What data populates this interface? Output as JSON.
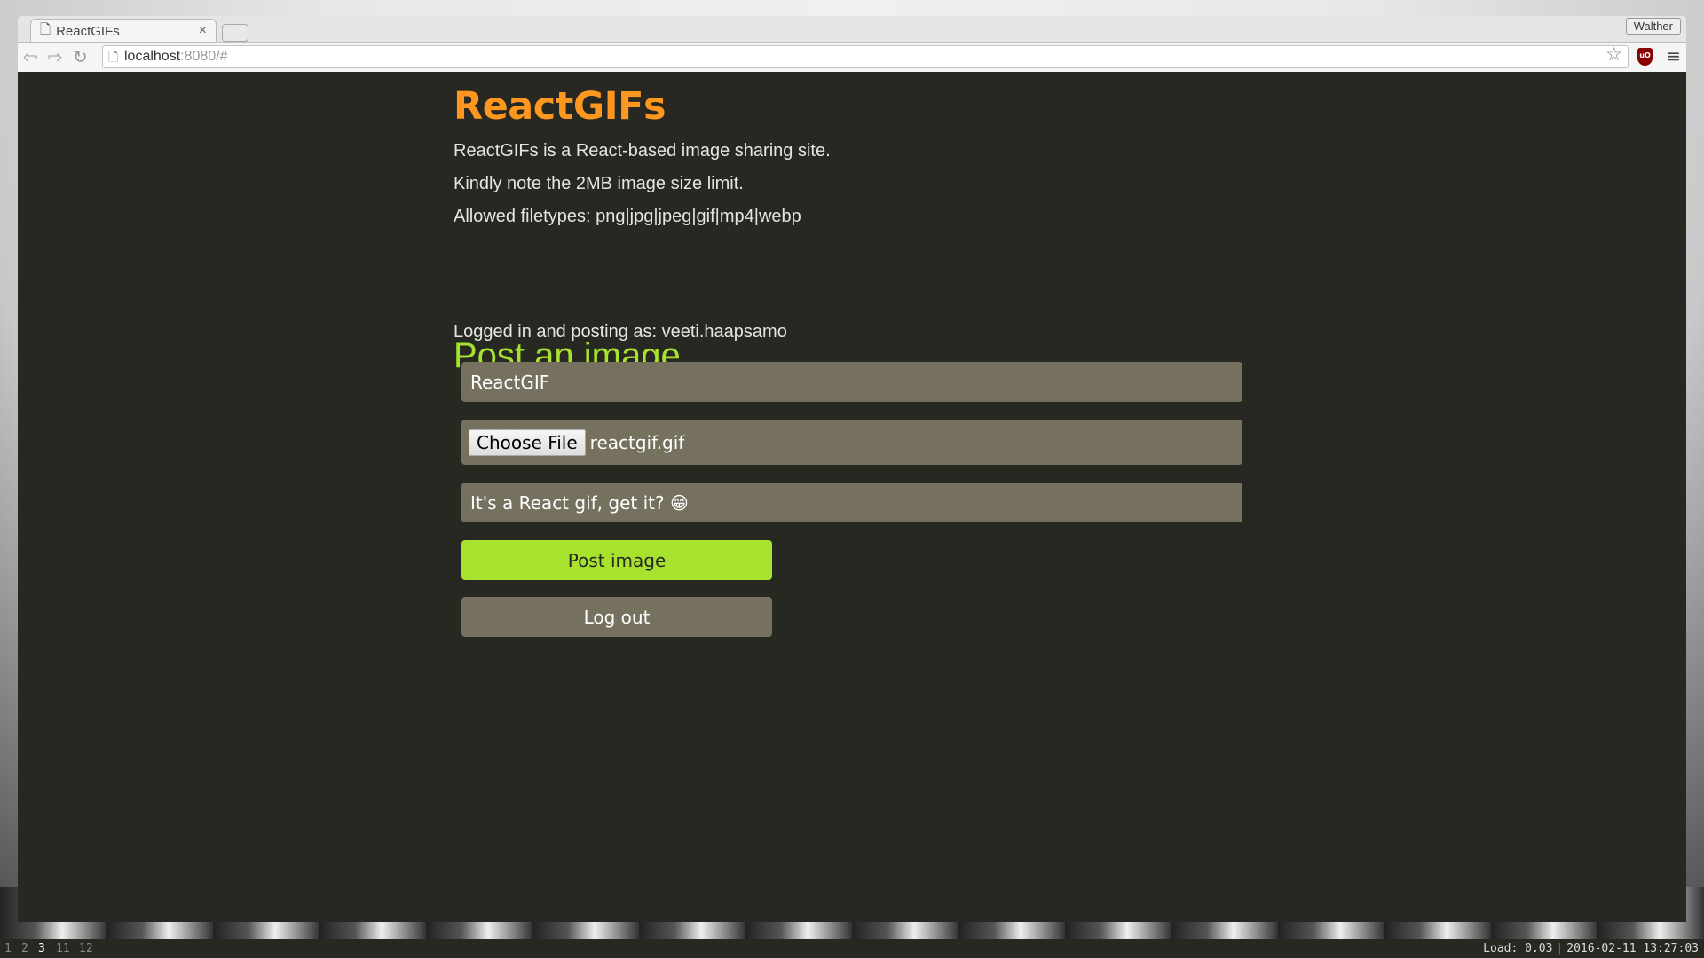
{
  "browser": {
    "tab_title": "ReactGIFs",
    "tab_close": "×",
    "profile": "Walther",
    "url_host": "localhost",
    "url_rest": ":8080/#",
    "ublock": "uO"
  },
  "page": {
    "title": "ReactGIFs",
    "lines": [
      "ReactGIFs is a React-based image sharing site.",
      "Kindly note the 2MB image size limit.",
      "Allowed filetypes: png|jpg|jpeg|gif|mp4|webp"
    ],
    "section_title": "Post an image",
    "logged_in": "Logged in and posting as: veeti.haapsamo",
    "form": {
      "title_value": "ReactGIF",
      "choose_file": "Choose File",
      "file_name": "reactgif.gif",
      "description_value": "It's a React gif, get it? 😁",
      "post_label": "Post image",
      "logout_label": "Log out"
    }
  },
  "statusbar": {
    "workspaces": [
      "1",
      "2",
      "3",
      "11",
      "12"
    ],
    "active": "3",
    "load": "Load: 0.03",
    "datetime": "2016-02-11 13:27:03"
  },
  "colors": {
    "background": "#272822",
    "title": "#fd971f",
    "accent": "#a6e22e",
    "field": "#75715e"
  }
}
